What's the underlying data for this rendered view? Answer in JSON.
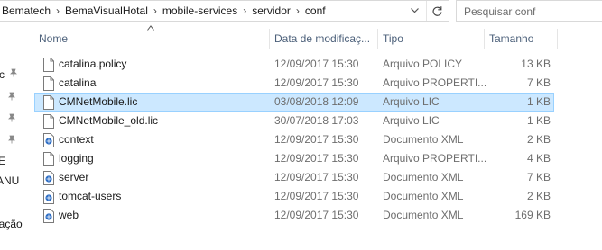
{
  "breadcrumb": [
    "Bematech",
    "BemaVisualHotal",
    "mobile-services",
    "servidor",
    "conf"
  ],
  "search": {
    "placeholder": "Pesquisar conf"
  },
  "nav_fragments": [
    "c",
    "E",
    "ANU",
    "nação"
  ],
  "columns": {
    "name": "Nome",
    "date": "Data de modificaç...",
    "type": "Tipo",
    "size": "Tamanho"
  },
  "files": [
    {
      "name": "catalina.policy",
      "date": "12/09/2017 15:30",
      "type": "Arquivo POLICY",
      "size": "13 KB",
      "icon": "file-icon",
      "selected": false
    },
    {
      "name": "catalina",
      "date": "12/09/2017 15:30",
      "type": "Arquivo PROPERTI...",
      "size": "7 KB",
      "icon": "file-icon",
      "selected": false
    },
    {
      "name": "CMNetMobile.lic",
      "date": "03/08/2018 12:09",
      "type": "Arquivo LIC",
      "size": "1 KB",
      "icon": "file-icon",
      "selected": true
    },
    {
      "name": "CMNetMobile_old.lic",
      "date": "30/07/2018 17:03",
      "type": "Arquivo LIC",
      "size": "1 KB",
      "icon": "file-icon",
      "selected": false
    },
    {
      "name": "context",
      "date": "12/09/2017 15:30",
      "type": "Documento XML",
      "size": "2 KB",
      "icon": "xml-file-icon",
      "selected": false
    },
    {
      "name": "logging",
      "date": "12/09/2017 15:30",
      "type": "Arquivo PROPERTI...",
      "size": "4 KB",
      "icon": "file-icon",
      "selected": false
    },
    {
      "name": "server",
      "date": "12/09/2017 15:30",
      "type": "Documento XML",
      "size": "7 KB",
      "icon": "xml-file-icon",
      "selected": false
    },
    {
      "name": "tomcat-users",
      "date": "12/09/2017 15:30",
      "type": "Documento XML",
      "size": "2 KB",
      "icon": "xml-file-icon",
      "selected": false
    },
    {
      "name": "web",
      "date": "12/09/2017 15:30",
      "type": "Documento XML",
      "size": "169 KB",
      "icon": "xml-file-icon",
      "selected": false
    }
  ],
  "colors": {
    "selection_bg": "#cce8ff",
    "selection_border": "#99d1ff",
    "header_text": "#4c607a",
    "meta_text": "#6d6d6d"
  }
}
